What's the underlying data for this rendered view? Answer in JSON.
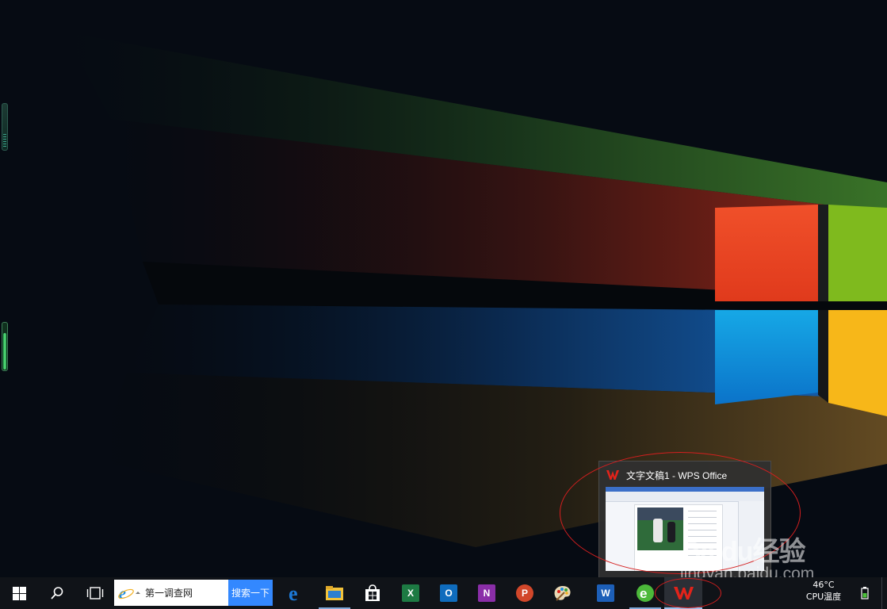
{
  "preview": {
    "title": "文字文稿1 - WPS Office"
  },
  "taskbar": {
    "search_text": "第一调查网",
    "search_button": "搜索一下"
  },
  "tray": {
    "temperature": "46°C",
    "temp_label": "CPU温度"
  },
  "watermark": {
    "logo": "Baidu经验",
    "url": "jingyan.baidu.com"
  },
  "colors": {
    "annotation": "#d41f1f",
    "search_button": "#3388ff",
    "wps": "#e2231a"
  }
}
